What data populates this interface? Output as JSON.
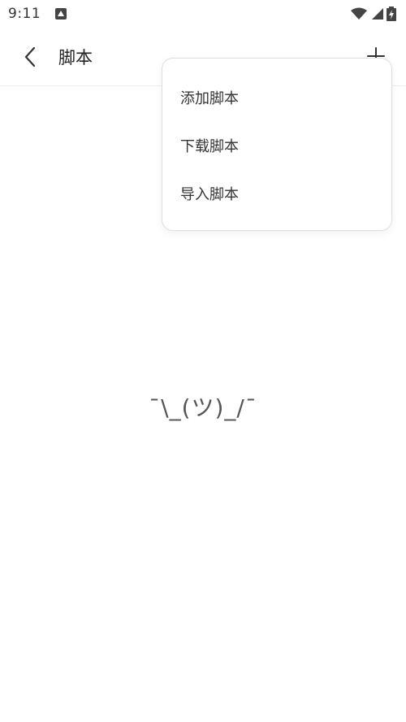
{
  "status_bar": {
    "time": "9:11",
    "icons": [
      "notification-a-icon",
      "wifi-icon",
      "signal-icon",
      "battery-icon"
    ]
  },
  "toolbar": {
    "back_icon": "chevron-left-icon",
    "title": "脚本",
    "add_icon": "plus-icon"
  },
  "menu": {
    "items": [
      {
        "label": "添加脚本"
      },
      {
        "label": "下载脚本"
      },
      {
        "label": "导入脚本"
      }
    ]
  },
  "empty_state": {
    "text": "¯\\_(ツ)_/¯"
  },
  "colors": {
    "background": "#ffffff",
    "text": "#222222",
    "divider": "#ececec",
    "menu_border": "#dedede"
  }
}
